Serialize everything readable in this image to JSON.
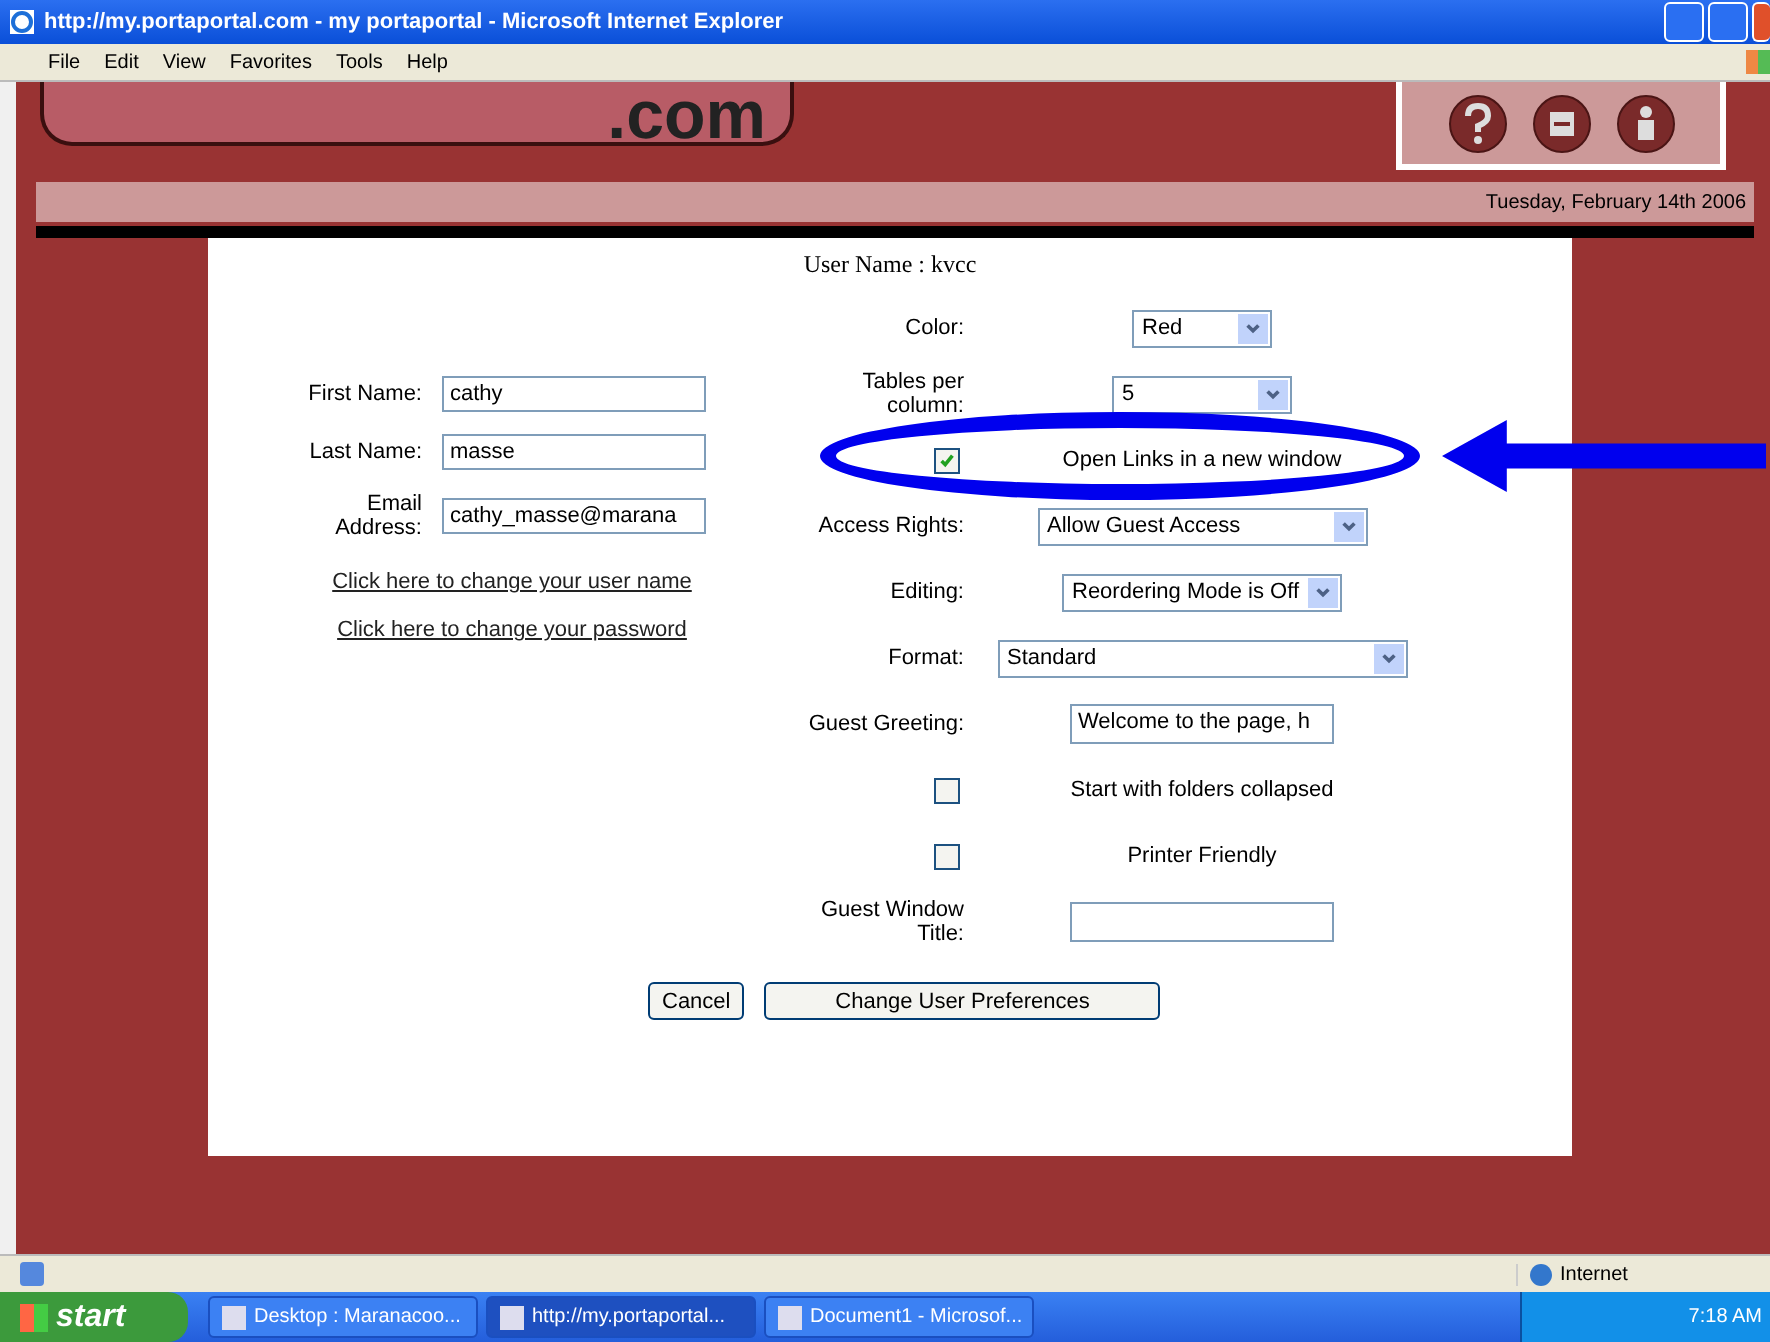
{
  "window": {
    "title": "http://my.portaportal.com - my portaportal - Microsoft Internet Explorer"
  },
  "menu": [
    "File",
    "Edit",
    "View",
    "Favorites",
    "Tools",
    "Help"
  ],
  "logo_text": ".com",
  "date": "Tuesday, February 14th 2006",
  "username": "User Name : kvcc",
  "profile_fields": [
    {
      "label": "First Name:",
      "value": "cathy"
    },
    {
      "label": "Last Name:",
      "value": "masse"
    },
    {
      "label": "Email Address:",
      "value": "cathy_masse@marana"
    }
  ],
  "links": [
    "Click here to change your user name",
    "Click here to change your password"
  ],
  "settings": [
    {
      "kind": "select",
      "label": "Color:",
      "value": "Red"
    },
    {
      "kind": "select",
      "label": "Tables per column:",
      "value": "5"
    },
    {
      "kind": "checkbox",
      "label": "Open Links in a new window",
      "checked": true,
      "highlighted": true
    },
    {
      "kind": "select",
      "label": "Access Rights:",
      "value": "Allow Guest Access"
    },
    {
      "kind": "select",
      "label": "Editing:",
      "value": "Reordering Mode is Off"
    },
    {
      "kind": "select",
      "label": "Format:",
      "value": "Standard"
    },
    {
      "kind": "text",
      "label": "Guest Greeting:",
      "value": "Welcome to the page, h"
    },
    {
      "kind": "checkbox",
      "label": "Start with folders collapsed",
      "checked": false,
      "highlighted": false
    },
    {
      "kind": "checkbox",
      "label": "Printer Friendly",
      "checked": false,
      "highlighted": false
    },
    {
      "kind": "text",
      "label": "Guest Window Title:"
    }
  ],
  "buttons": [
    "Cancel",
    "Change User Preferences"
  ],
  "status_bar": {
    "zone": "Internet"
  },
  "taskbar": {
    "start": "start",
    "tasks": [
      {
        "label": "Desktop : Maranacoo...",
        "selected": false
      },
      {
        "label": "http://my.portaportal...",
        "selected": true
      },
      {
        "label": "Document1 - Microsof...",
        "selected": false
      }
    ],
    "clock": "7:18 AM"
  }
}
